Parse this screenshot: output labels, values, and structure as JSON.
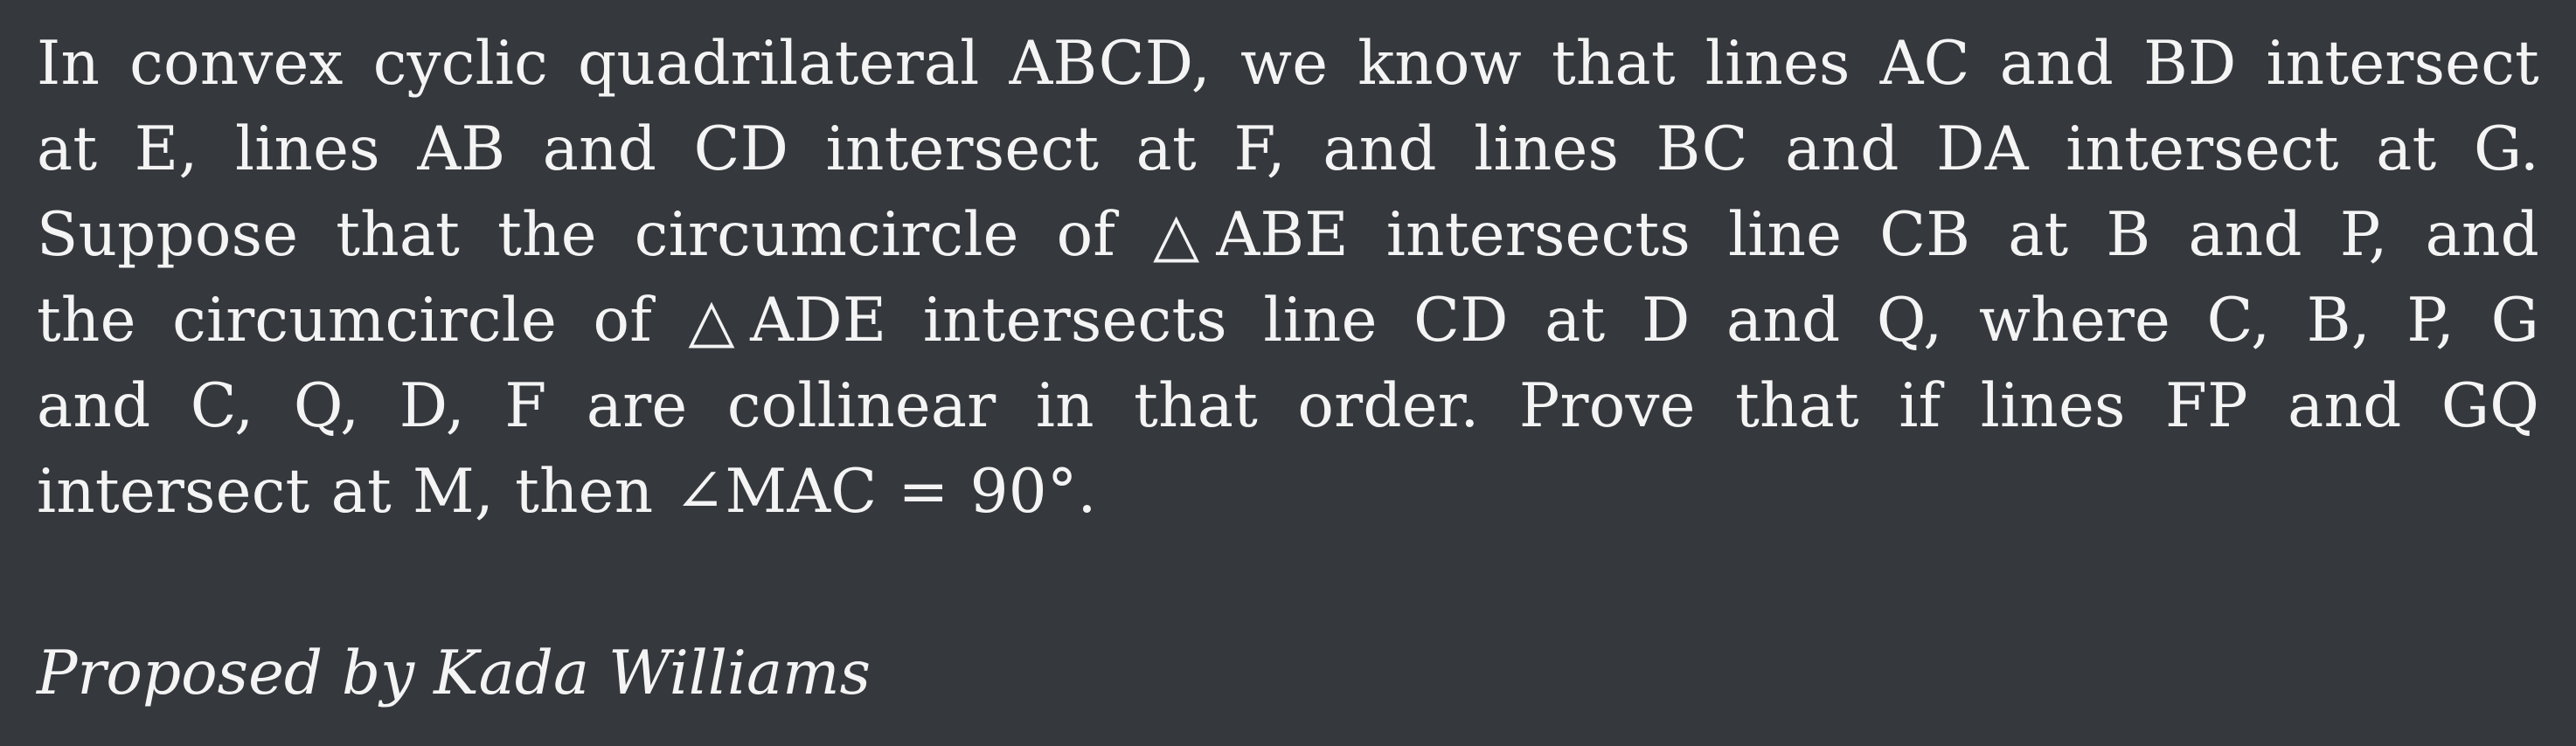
{
  "problem": {
    "line1": "In convex cyclic quadrilateral ABCD, we know that lines AC and BD intersect",
    "line2": "at E, lines AB and CD intersect at F, and lines BC and DA intersect at G.",
    "line3": "Suppose that the circumcircle of △ABE intersects line CB at B and P, and",
    "line4": "the circumcircle of △ADE intersects line CD at D and Q, where C, B, P, G",
    "line5": "and C, Q, D, F are collinear in that order. Prove that if lines FP and GQ",
    "line6": "intersect at M, then ∠MAC = 90°."
  },
  "credit": "Proposed by Kada Williams"
}
